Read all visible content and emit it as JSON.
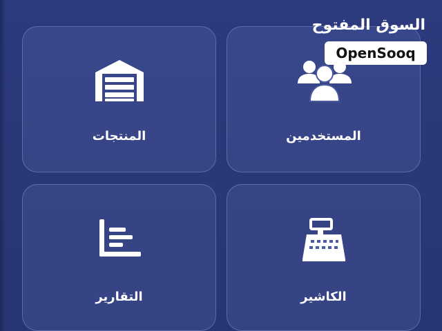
{
  "tiles": {
    "products": {
      "label": "المنتجات",
      "icon": "warehouse-icon"
    },
    "users": {
      "label": "المستخدمين",
      "icon": "users-group-icon"
    },
    "reports": {
      "label": "التقارير",
      "icon": "report-list-icon"
    },
    "cashier": {
      "label": "الكاشير",
      "icon": "cash-register-icon"
    }
  },
  "watermark": {
    "arabic": "السوق المفتوح",
    "english": "OpenSooq"
  },
  "colors": {
    "background": "#2c3a7e",
    "tile": "#4a5a9e",
    "icon": "#ffffff"
  }
}
